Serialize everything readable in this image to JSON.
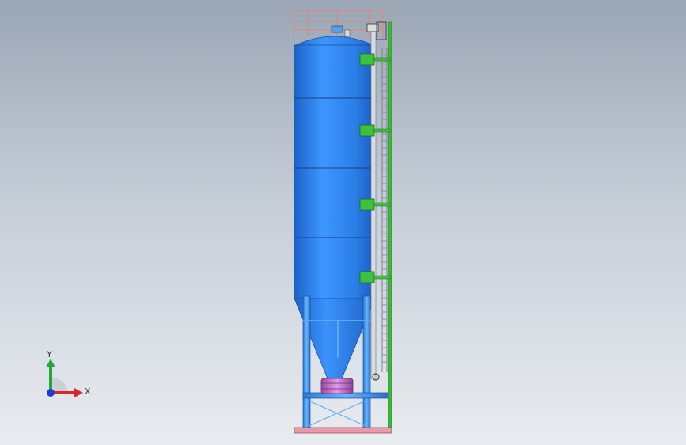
{
  "viewport": {
    "background_top": "#9ba6b5",
    "background_bottom": "#e9ecf0"
  },
  "model": {
    "tank_color": "#2d7fe0",
    "frame_color": "#3f95df",
    "ladder_color": "#b0b7c1",
    "bracket_color": "#3ec23e",
    "flange_color": "#cc66cc",
    "base_plate_color": "#e79aa8",
    "railing_color": "#d59a8e"
  },
  "triad": {
    "y_label": "Y",
    "x_label": "X",
    "y_color": "#22a63a",
    "x_color": "#d62828",
    "z_color": "#1f3ad6"
  }
}
